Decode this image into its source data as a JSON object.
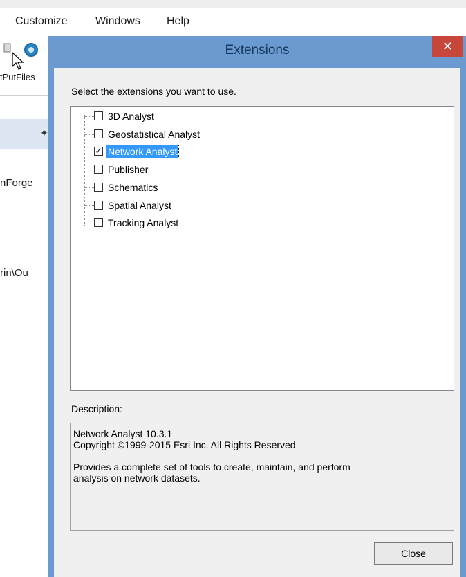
{
  "menubar": {
    "items": [
      "Customize",
      "Windows",
      "Help"
    ]
  },
  "background": {
    "toolbar_fragment": "tPutFiles",
    "text_fragments": [
      "nForge",
      "rin\\Ou"
    ]
  },
  "dialog": {
    "title": "Extensions",
    "instruction": "Select the extensions you want to use.",
    "extensions": [
      {
        "label": "3D Analyst",
        "checked": false,
        "selected": false
      },
      {
        "label": "Geostatistical Analyst",
        "checked": false,
        "selected": false
      },
      {
        "label": "Network Analyst",
        "checked": true,
        "selected": true
      },
      {
        "label": "Publisher",
        "checked": false,
        "selected": false
      },
      {
        "label": "Schematics",
        "checked": false,
        "selected": false
      },
      {
        "label": "Spatial Analyst",
        "checked": false,
        "selected": false
      },
      {
        "label": "Tracking Analyst",
        "checked": false,
        "selected": false
      }
    ],
    "description_label": "Description:",
    "description_lines": [
      "Network Analyst 10.3.1",
      "Copyright ©1999-2015 Esri Inc. All Rights Reserved",
      "",
      "Provides a complete set of tools to create, maintain, and perform",
      "analysis on network datasets."
    ],
    "close_button": "Close",
    "close_glyph": "✕"
  },
  "colors": {
    "title_bar": "#6a9ad0",
    "close_red": "#c7483a",
    "selection": "#3399ff"
  },
  "icons": [
    "search-icon",
    "mouse-cursor-icon",
    "pin-icon",
    "close-icon",
    "checkbox-icon"
  ]
}
